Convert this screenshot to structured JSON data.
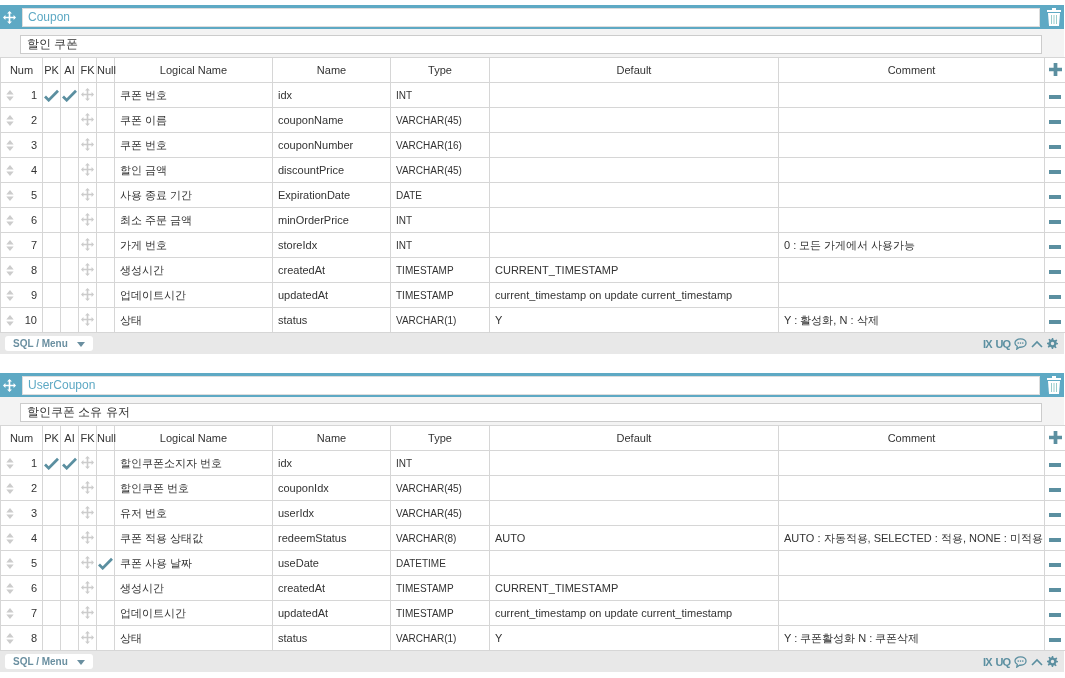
{
  "tables": [
    {
      "name": "Coupon",
      "comment": "할인 쿠폰",
      "columns": [
        "Num",
        "PK",
        "AI",
        "FK",
        "Null",
        "Logical Name",
        "Name",
        "Type",
        "Default",
        "Comment"
      ],
      "menu": "SQL / Menu",
      "footer_labels": [
        "IX",
        "UQ"
      ],
      "rows": [
        {
          "num": "1",
          "pk": true,
          "ai": true,
          "null": false,
          "logical": "쿠폰 번호",
          "name": "idx",
          "type": "INT",
          "default": "",
          "comment": ""
        },
        {
          "num": "2",
          "pk": false,
          "ai": false,
          "null": false,
          "logical": "쿠폰 이름",
          "name": "couponName",
          "type": "VARCHAR(45)",
          "default": "",
          "comment": ""
        },
        {
          "num": "3",
          "pk": false,
          "ai": false,
          "null": false,
          "logical": "쿠폰 번호",
          "name": "couponNumber",
          "type": "VARCHAR(16)",
          "default": "",
          "comment": ""
        },
        {
          "num": "4",
          "pk": false,
          "ai": false,
          "null": false,
          "logical": "할인 금액",
          "name": "discountPrice",
          "type": "VARCHAR(45)",
          "default": "",
          "comment": ""
        },
        {
          "num": "5",
          "pk": false,
          "ai": false,
          "null": false,
          "logical": "사용 종료 기간",
          "name": "ExpirationDate",
          "type": "DATE",
          "default": "",
          "comment": ""
        },
        {
          "num": "6",
          "pk": false,
          "ai": false,
          "null": false,
          "logical": "최소 주문 금액",
          "name": "minOrderPrice",
          "type": "INT",
          "default": "",
          "comment": ""
        },
        {
          "num": "7",
          "pk": false,
          "ai": false,
          "null": false,
          "logical": "가게 번호",
          "name": "storeIdx",
          "type": "INT",
          "default": "",
          "comment": "0 : 모든 가게에서 사용가능"
        },
        {
          "num": "8",
          "pk": false,
          "ai": false,
          "null": false,
          "logical": "생성시간",
          "name": "createdAt",
          "type": "TIMESTAMP",
          "default": "CURRENT_TIMESTAMP",
          "comment": ""
        },
        {
          "num": "9",
          "pk": false,
          "ai": false,
          "null": false,
          "logical": "업데이트시간",
          "name": "updatedAt",
          "type": "TIMESTAMP",
          "default": "current_timestamp on update current_timestamp",
          "comment": ""
        },
        {
          "num": "10",
          "pk": false,
          "ai": false,
          "null": false,
          "logical": "상태",
          "name": "status",
          "type": "VARCHAR(1)",
          "default": "Y",
          "comment": "Y : 활성화, N : 삭제"
        }
      ]
    },
    {
      "name": "UserCoupon",
      "comment": "할인쿠폰 소유 유저",
      "columns": [
        "Num",
        "PK",
        "AI",
        "FK",
        "Null",
        "Logical Name",
        "Name",
        "Type",
        "Default",
        "Comment"
      ],
      "menu": "SQL / Menu",
      "footer_labels": [
        "IX",
        "UQ"
      ],
      "rows": [
        {
          "num": "1",
          "pk": true,
          "ai": true,
          "null": false,
          "logical": "할인쿠폰소지자 번호",
          "name": "idx",
          "type": "INT",
          "default": "",
          "comment": ""
        },
        {
          "num": "2",
          "pk": false,
          "ai": false,
          "null": false,
          "logical": "할인쿠폰 번호",
          "name": "couponIdx",
          "type": "VARCHAR(45)",
          "default": "",
          "comment": ""
        },
        {
          "num": "3",
          "pk": false,
          "ai": false,
          "null": false,
          "logical": "유저 번호",
          "name": "userIdx",
          "type": "VARCHAR(45)",
          "default": "",
          "comment": ""
        },
        {
          "num": "4",
          "pk": false,
          "ai": false,
          "null": false,
          "logical": "쿠폰 적용 상태값",
          "name": "redeemStatus",
          "type": "VARCHAR(8)",
          "default": "AUTO",
          "comment": "AUTO : 자동적용, SELECTED : 적용, NONE : 미적용"
        },
        {
          "num": "5",
          "pk": false,
          "ai": false,
          "null": true,
          "logical": "쿠폰 사용 날짜",
          "name": "useDate",
          "type": "DATETIME",
          "default": "",
          "comment": ""
        },
        {
          "num": "6",
          "pk": false,
          "ai": false,
          "null": false,
          "logical": "생성시간",
          "name": "createdAt",
          "type": "TIMESTAMP",
          "default": "CURRENT_TIMESTAMP",
          "comment": ""
        },
        {
          "num": "7",
          "pk": false,
          "ai": false,
          "null": false,
          "logical": "업데이트시간",
          "name": "updatedAt",
          "type": "TIMESTAMP",
          "default": "current_timestamp on update current_timestamp",
          "comment": ""
        },
        {
          "num": "8",
          "pk": false,
          "ai": false,
          "null": false,
          "logical": "상태",
          "name": "status",
          "type": "VARCHAR(1)",
          "default": "Y",
          "comment": "Y : 쿠폰활성화 N : 쿠폰삭제"
        }
      ]
    }
  ]
}
